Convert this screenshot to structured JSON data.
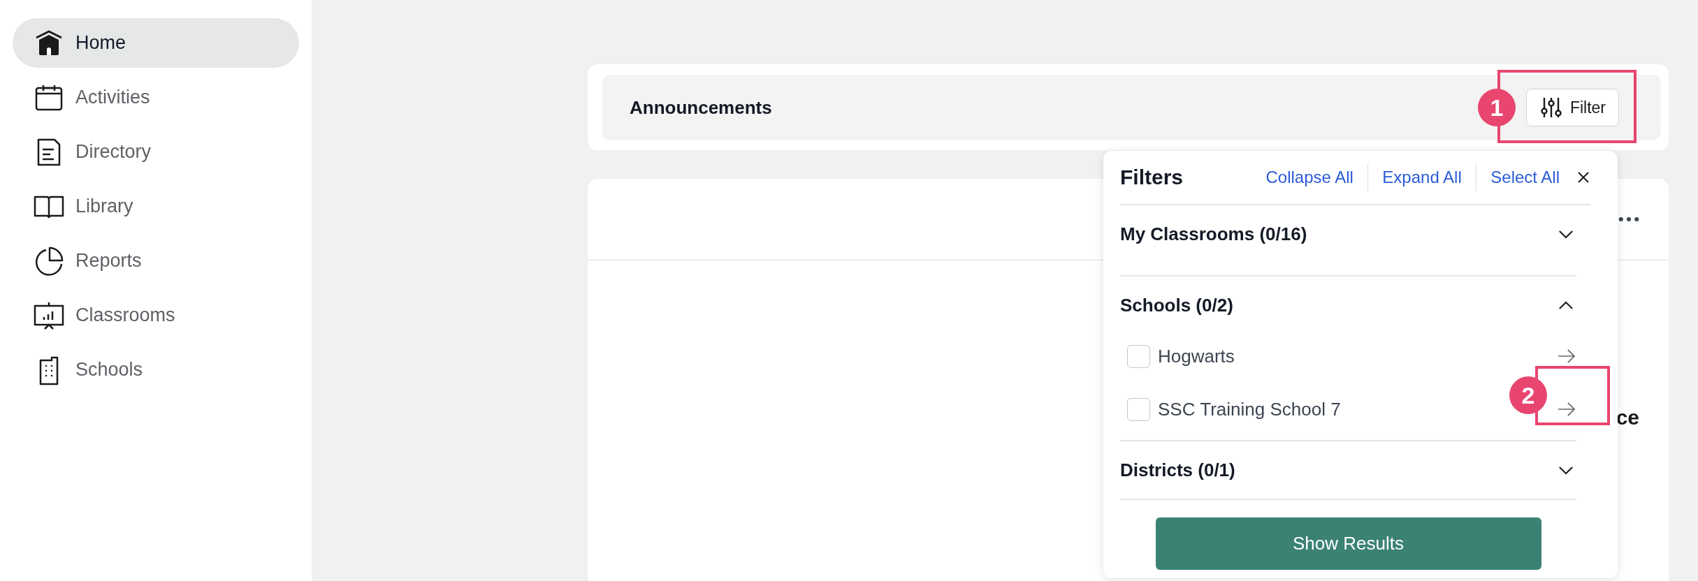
{
  "sidebar": {
    "items": [
      {
        "label": "Home",
        "selected": true
      },
      {
        "label": "Activities",
        "selected": false
      },
      {
        "label": "Directory",
        "selected": false
      },
      {
        "label": "Library",
        "selected": false
      },
      {
        "label": "Reports",
        "selected": false
      },
      {
        "label": "Classrooms",
        "selected": false
      },
      {
        "label": "Schools",
        "selected": false
      }
    ]
  },
  "announcements": {
    "title": "Announcements",
    "filter_button": "Filter"
  },
  "card": {
    "text": "ce"
  },
  "filters": {
    "title": "Filters",
    "actions": [
      "Collapse All",
      "Expand All",
      "Select All"
    ],
    "sections": [
      {
        "title": "My Classrooms (0/16)",
        "expanded": false
      },
      {
        "title": "Schools (0/2)",
        "expanded": true,
        "items": [
          {
            "label": "Hogwarts",
            "checked": false
          },
          {
            "label": "SSC Training School 7",
            "checked": false
          }
        ]
      },
      {
        "title": "Districts (0/1)",
        "expanded": false
      }
    ],
    "submit": "Show Results"
  },
  "annotations": [
    {
      "label": "1"
    },
    {
      "label": "2"
    }
  ]
}
